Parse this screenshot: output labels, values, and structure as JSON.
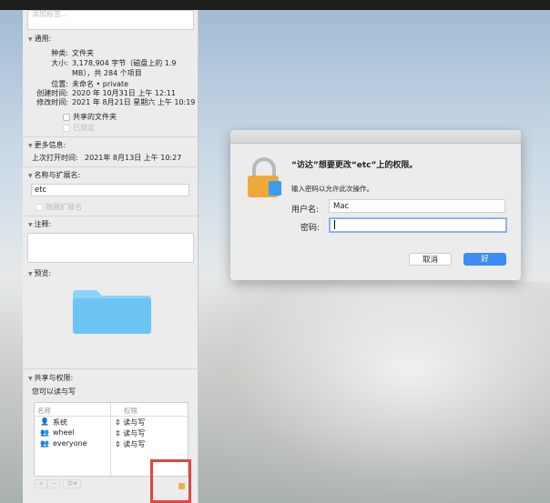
{
  "info_panel": {
    "tags_placeholder": "添加标签...",
    "general": {
      "header": "通用:",
      "kind_label": "种类:",
      "kind": "文件夹",
      "size_label": "大小:",
      "size_line1": "3,178,904 字节（磁盘上的 1.9",
      "size_line2": "MB），共 284 个项目",
      "where_label": "位置:",
      "where": "未命名 • private",
      "created_label": "创建时间:",
      "created": "2020 年 10月31日 上午 12:11",
      "modified_label": "修改时间:",
      "modified": "2021 年 8月21日 星期六 上午 10:19",
      "shared_folder": "共享的文件夹",
      "locked": "已锁定"
    },
    "more_info": {
      "header": "更多信息:",
      "last_opened_label": "上次打开时间:",
      "last_opened": "2021年 8月13日 上午 10:27"
    },
    "name_ext": {
      "header": "名称与扩展名:",
      "name": "etc",
      "hide_ext": "隐藏扩展名"
    },
    "comments": {
      "header": "注释:"
    },
    "preview": {
      "header": "预览:"
    },
    "sharing": {
      "header": "共享与权限:",
      "status": "您可以读与写",
      "col_name": "名称",
      "col_priv": "权限",
      "rows": [
        {
          "name": "系统",
          "priv": "读与写"
        },
        {
          "name": "wheel",
          "priv": "读与写"
        },
        {
          "name": "everyone",
          "priv": "读与写"
        }
      ],
      "add": "+",
      "remove": "−",
      "gear": "⚙▾"
    }
  },
  "dialog": {
    "title": "“访达”想要更改“etc”上的权限。",
    "message": "输入密码以允许此次操作。",
    "user_label": "用户名:",
    "user_value": "Mac",
    "pass_label": "密码:",
    "pass_value": "",
    "cancel": "取消",
    "ok": "好"
  },
  "colors": {
    "accent": "#3b8cf4",
    "highlight": "#e0473a",
    "folder": "#6cc4f5"
  }
}
